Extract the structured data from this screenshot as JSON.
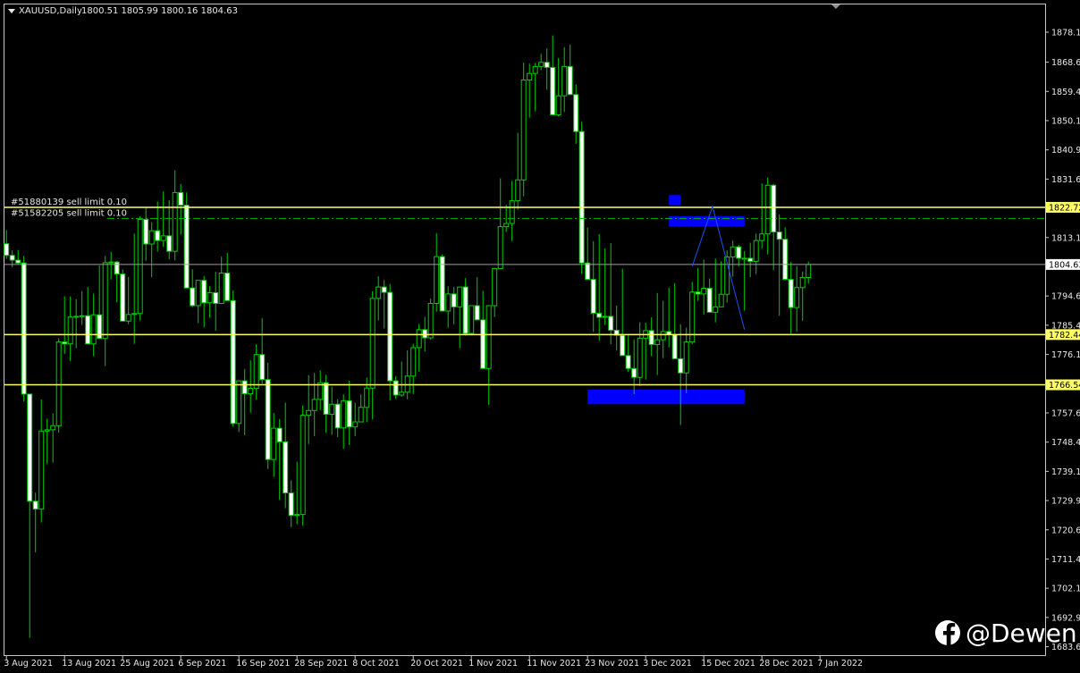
{
  "header": {
    "symbol": "XAUUSD,Daily",
    "ohlc": "1800.51 1805.99 1800.16 1804.63"
  },
  "order_labels": [
    "#51880139 sell limit 0.10",
    "#51582205 sell limit 0.10"
  ],
  "watermark": "@Dewen",
  "colors": {
    "background": "#000000",
    "bull_candle": "#000000",
    "bear_candle": "#ffffff",
    "wick": "#00cc00",
    "level_line": "#ffff66",
    "price_line": "#a0a0a0",
    "order_line": "#00bb00",
    "zone": "#0000ff",
    "projection": "#1e50ff"
  },
  "icons": [
    "dropdown-triangle-icon",
    "facebook-icon"
  ],
  "chart_data": {
    "type": "candlestick",
    "symbol": "XAUUSD",
    "timeframe": "Daily",
    "ylim": [
      1683.65,
      1882.5
    ],
    "y_ticks": [
      "1878.15",
      "1868.65",
      "1859.40",
      "1850.15",
      "1840.90",
      "1831.65",
      "1822.72",
      "1813.15",
      "1804.63",
      "1794.65",
      "1785.40",
      "1782.44",
      "1776.15",
      "1766.54",
      "1757.65",
      "1748.40",
      "1739.15",
      "1729.90",
      "1720.65",
      "1711.40",
      "1702.15",
      "1692.90",
      "1683.65"
    ],
    "x_labels": [
      "3 Aug 2021",
      "13 Aug 2021",
      "25 Aug 2021",
      "6 Sep 2021",
      "16 Sep 2021",
      "28 Sep 2021",
      "8 Oct 2021",
      "20 Oct 2021",
      "1 Nov 2021",
      "11 Nov 2021",
      "23 Nov 2021",
      "3 Dec 2021",
      "15 Dec 2021",
      "28 Dec 2021",
      "7 Jan 2022"
    ],
    "horizontal_levels": [
      {
        "price": 1822.72,
        "label": "1822.72",
        "style": "solid"
      },
      {
        "price": 1782.44,
        "label": "1782.44",
        "style": "solid"
      },
      {
        "price": 1766.54,
        "label": "1766.54",
        "style": "solid"
      }
    ],
    "current_price": {
      "price": 1804.63,
      "label": "1804.63"
    },
    "order_lines": [
      {
        "price": 1822.72,
        "label": "#51880139 sell limit 0.10"
      },
      {
        "price": 1819.2,
        "label": "#51582205 sell limit 0.10"
      }
    ],
    "zones": [
      {
        "start_bar": 114,
        "end_bar": 116,
        "top": 1826.6,
        "bottom": 1823.4
      },
      {
        "start_bar": 114,
        "end_bar": 127,
        "top": 1819.9,
        "bottom": 1816.6
      },
      {
        "start_bar": 100,
        "end_bar": 127,
        "top": 1765.0,
        "bottom": 1760.4
      }
    ],
    "projection": [
      {
        "bar": 118,
        "price": 1804.0
      },
      {
        "bar": 121.5,
        "price": 1823.0
      },
      {
        "bar": 127,
        "price": 1784.0
      }
    ],
    "candles": [
      [
        1811.2,
        1815.5,
        1806.4,
        1807.5
      ],
      [
        1807.5,
        1809.1,
        1803.8,
        1806.0
      ],
      [
        1806.0,
        1809.2,
        1804.7,
        1805.1
      ],
      [
        1805.1,
        1807.3,
        1761.3,
        1763.6
      ],
      [
        1763.6,
        1762.6,
        1686.5,
        1729.7
      ],
      [
        1729.7,
        1732.4,
        1713.5,
        1727.2
      ],
      [
        1727.2,
        1761.9,
        1723.0,
        1751.9
      ],
      [
        1751.9,
        1755.8,
        1741.4,
        1752.3
      ],
      [
        1752.3,
        1757.5,
        1741.9,
        1753.6
      ],
      [
        1753.6,
        1781.3,
        1751.4,
        1780.1
      ],
      [
        1780.1,
        1794.6,
        1776.3,
        1779.5
      ],
      [
        1779.5,
        1794.5,
        1774.1,
        1788.0
      ],
      [
        1788.0,
        1793.6,
        1778.1,
        1788.2
      ],
      [
        1788.2,
        1796.2,
        1785.5,
        1788.4
      ],
      [
        1788.4,
        1797.5,
        1782.1,
        1779.5
      ],
      [
        1779.5,
        1795.4,
        1775.6,
        1788.7
      ],
      [
        1788.7,
        1804.3,
        1783.4,
        1781.2
      ],
      [
        1781.2,
        1807.3,
        1772.5,
        1805.2
      ],
      [
        1805.2,
        1808.6,
        1799.9,
        1805.4
      ],
      [
        1805.4,
        1805.7,
        1792.7,
        1801.6
      ],
      [
        1801.6,
        1803.1,
        1790.4,
        1786.7
      ],
      [
        1786.7,
        1800.7,
        1785.7,
        1788.8
      ],
      [
        1788.8,
        1814.4,
        1779.5,
        1789.1
      ],
      [
        1789.1,
        1819.9,
        1786.9,
        1818.9
      ],
      [
        1818.9,
        1822.6,
        1805.8,
        1811.1
      ],
      [
        1811.1,
        1818.0,
        1800.6,
        1815.3
      ],
      [
        1815.3,
        1824.5,
        1808.7,
        1812.2
      ],
      [
        1812.2,
        1827.7,
        1810.2,
        1813.7
      ],
      [
        1813.7,
        1825.0,
        1806.3,
        1808.8
      ],
      [
        1808.8,
        1834.4,
        1805.9,
        1827.4
      ],
      [
        1827.4,
        1830.1,
        1814.1,
        1823.4
      ],
      [
        1823.4,
        1827.4,
        1797.0,
        1797.2
      ],
      [
        1797.2,
        1803.1,
        1791.1,
        1791.6
      ],
      [
        1791.6,
        1799.6,
        1786.1,
        1799.6
      ],
      [
        1799.6,
        1801.0,
        1784.7,
        1792.5
      ],
      [
        1792.5,
        1797.8,
        1787.8,
        1795.7
      ],
      [
        1795.7,
        1802.3,
        1783.7,
        1792.3
      ],
      [
        1792.3,
        1807.1,
        1794.2,
        1801.9
      ],
      [
        1801.9,
        1808.3,
        1795.0,
        1793.2
      ],
      [
        1793.2,
        1796.4,
        1753.3,
        1754.3
      ],
      [
        1754.3,
        1768.0,
        1751.6,
        1767.8
      ],
      [
        1767.8,
        1771.6,
        1750.6,
        1763.7
      ],
      [
        1763.7,
        1774.3,
        1757.7,
        1765.4
      ],
      [
        1765.4,
        1779.4,
        1761.8,
        1776.1
      ],
      [
        1776.1,
        1787.6,
        1766.9,
        1768.2
      ],
      [
        1768.2,
        1773.5,
        1739.9,
        1742.9
      ],
      [
        1742.9,
        1757.6,
        1737.4,
        1752.8
      ],
      [
        1752.8,
        1755.7,
        1730.1,
        1748.5
      ],
      [
        1748.5,
        1760.9,
        1727.5,
        1732.3
      ],
      [
        1732.3,
        1736.3,
        1721.5,
        1725.2
      ],
      [
        1725.2,
        1742.2,
        1722.4,
        1725.5
      ],
      [
        1725.5,
        1760.0,
        1721.9,
        1756.9
      ],
      [
        1756.9,
        1769.6,
        1747.8,
        1758.4
      ],
      [
        1758.4,
        1770.3,
        1750.3,
        1761.9
      ],
      [
        1761.9,
        1771.1,
        1758.6,
        1767.2
      ],
      [
        1767.2,
        1769.7,
        1751.3,
        1757.2
      ],
      [
        1757.2,
        1765.9,
        1750.7,
        1760.4
      ],
      [
        1760.4,
        1762.0,
        1750.0,
        1752.9
      ],
      [
        1752.9,
        1763.5,
        1746.3,
        1761.5
      ],
      [
        1761.5,
        1767.8,
        1747.5,
        1753.2
      ],
      [
        1753.2,
        1760.9,
        1750.3,
        1754.8
      ],
      [
        1754.8,
        1763.5,
        1756.1,
        1759.4
      ],
      [
        1759.4,
        1768.8,
        1754.7,
        1765.5
      ],
      [
        1765.5,
        1796.2,
        1755.6,
        1793.9
      ],
      [
        1793.9,
        1800.9,
        1786.9,
        1797.5
      ],
      [
        1797.5,
        1799.7,
        1784.4,
        1795.8
      ],
      [
        1795.8,
        1798.5,
        1761.6,
        1767.8
      ],
      [
        1767.8,
        1769.3,
        1762.1,
        1763.3
      ],
      [
        1763.3,
        1773.9,
        1762.7,
        1764.2
      ],
      [
        1764.2,
        1777.4,
        1762.0,
        1769.3
      ],
      [
        1769.3,
        1779.5,
        1763.6,
        1778.3
      ],
      [
        1778.3,
        1785.8,
        1770.7,
        1784.0
      ],
      [
        1784.0,
        1788.1,
        1777.1,
        1781.4
      ],
      [
        1781.4,
        1793.8,
        1780.8,
        1792.3
      ],
      [
        1792.3,
        1814.5,
        1789.7,
        1807.1
      ],
      [
        1807.1,
        1807.8,
        1789.9,
        1789.9
      ],
      [
        1789.9,
        1797.7,
        1784.6,
        1795.3
      ],
      [
        1795.3,
        1797.5,
        1785.7,
        1791.2
      ],
      [
        1791.2,
        1793.3,
        1778.1,
        1797.5
      ],
      [
        1797.5,
        1800.3,
        1782.1,
        1782.8
      ],
      [
        1782.8,
        1791.5,
        1782.2,
        1791.6
      ],
      [
        1791.6,
        1800.6,
        1786.9,
        1787.1
      ],
      [
        1787.1,
        1796.3,
        1773.9,
        1771.7
      ],
      [
        1771.7,
        1791.5,
        1760.2,
        1791.6
      ],
      [
        1791.6,
        1803.6,
        1788.0,
        1803.3
      ],
      [
        1803.3,
        1831.9,
        1805.2,
        1816.6
      ],
      [
        1816.6,
        1823.5,
        1814.9,
        1817.6
      ],
      [
        1817.6,
        1831.1,
        1812.0,
        1824.8
      ],
      [
        1824.8,
        1846.3,
        1822.0,
        1831.4
      ],
      [
        1831.4,
        1868.5,
        1826.2,
        1863.0
      ],
      [
        1863.0,
        1868.2,
        1851.1,
        1865.1
      ],
      [
        1865.1,
        1868.4,
        1853.1,
        1867.3
      ],
      [
        1867.3,
        1871.3,
        1866.1,
        1868.6
      ],
      [
        1868.6,
        1873.0,
        1859.9,
        1867.0
      ],
      [
        1867.0,
        1877.1,
        1852.3,
        1852.0
      ],
      [
        1852.0,
        1870.0,
        1851.5,
        1858.0
      ],
      [
        1858.0,
        1873.4,
        1852.9,
        1867.3
      ],
      [
        1867.3,
        1874.2,
        1858.8,
        1858.4
      ],
      [
        1858.4,
        1861.6,
        1842.8,
        1846.7
      ],
      [
        1846.7,
        1849.8,
        1801.7,
        1805.1
      ],
      [
        1805.1,
        1816.3,
        1801.4,
        1799.9
      ],
      [
        1799.9,
        1812.0,
        1783.3,
        1789.2
      ],
      [
        1789.2,
        1814.2,
        1780.5,
        1787.9
      ],
      [
        1787.9,
        1809.7,
        1785.5,
        1788.2
      ],
      [
        1788.2,
        1811.4,
        1779.4,
        1783.8
      ],
      [
        1783.8,
        1791.6,
        1777.4,
        1782.2
      ],
      [
        1782.2,
        1803.3,
        1777.6,
        1775.8
      ],
      [
        1775.8,
        1782.6,
        1770.6,
        1771.7
      ],
      [
        1771.7,
        1780.9,
        1763.6,
        1768.9
      ],
      [
        1768.9,
        1786.3,
        1766.1,
        1781.3
      ],
      [
        1781.3,
        1786.2,
        1768.2,
        1783.7
      ],
      [
        1783.7,
        1787.9,
        1775.6,
        1779.3
      ],
      [
        1779.3,
        1795.6,
        1769.6,
        1780.8
      ],
      [
        1780.8,
        1793.1,
        1775.0,
        1783.4
      ],
      [
        1783.4,
        1797.2,
        1778.4,
        1782.4
      ],
      [
        1782.4,
        1798.7,
        1775.7,
        1774.8
      ],
      [
        1774.8,
        1785.7,
        1753.8,
        1770.3
      ],
      [
        1770.3,
        1784.6,
        1763.9,
        1780.1
      ],
      [
        1780.1,
        1799.1,
        1779.4,
        1795.9
      ],
      [
        1795.9,
        1803.5,
        1793.1,
        1795.3
      ],
      [
        1795.3,
        1806.2,
        1788.7,
        1797.1
      ],
      [
        1797.1,
        1800.2,
        1789.5,
        1789.5
      ],
      [
        1789.5,
        1806.5,
        1786.3,
        1791.2
      ],
      [
        1791.2,
        1805.6,
        1791.2,
        1795.2
      ],
      [
        1795.2,
        1809.1,
        1792.6,
        1807.0
      ],
      [
        1807.0,
        1812.2,
        1800.8,
        1810.2
      ],
      [
        1810.2,
        1810.8,
        1804.0,
        1806.6
      ],
      [
        1806.6,
        1808.9,
        1790.0,
        1806.6
      ],
      [
        1806.6,
        1811.5,
        1800.6,
        1805.6
      ],
      [
        1805.6,
        1814.4,
        1801.6,
        1812.2
      ],
      [
        1812.2,
        1830.3,
        1809.6,
        1814.3
      ],
      [
        1814.3,
        1832.1,
        1807.8,
        1829.7
      ],
      [
        1829.7,
        1830.1,
        1802.8,
        1814.9
      ],
      [
        1814.9,
        1820.5,
        1788.4,
        1812.6
      ],
      [
        1812.6,
        1816.4,
        1799.6,
        1799.9
      ],
      [
        1799.9,
        1805.4,
        1782.3,
        1791.0
      ],
      [
        1791.0,
        1804.1,
        1783.3,
        1797.3
      ],
      [
        1797.3,
        1802.4,
        1786.8,
        1800.5
      ],
      [
        1800.5,
        1805.5,
        1798.5,
        1804.6
      ]
    ]
  }
}
